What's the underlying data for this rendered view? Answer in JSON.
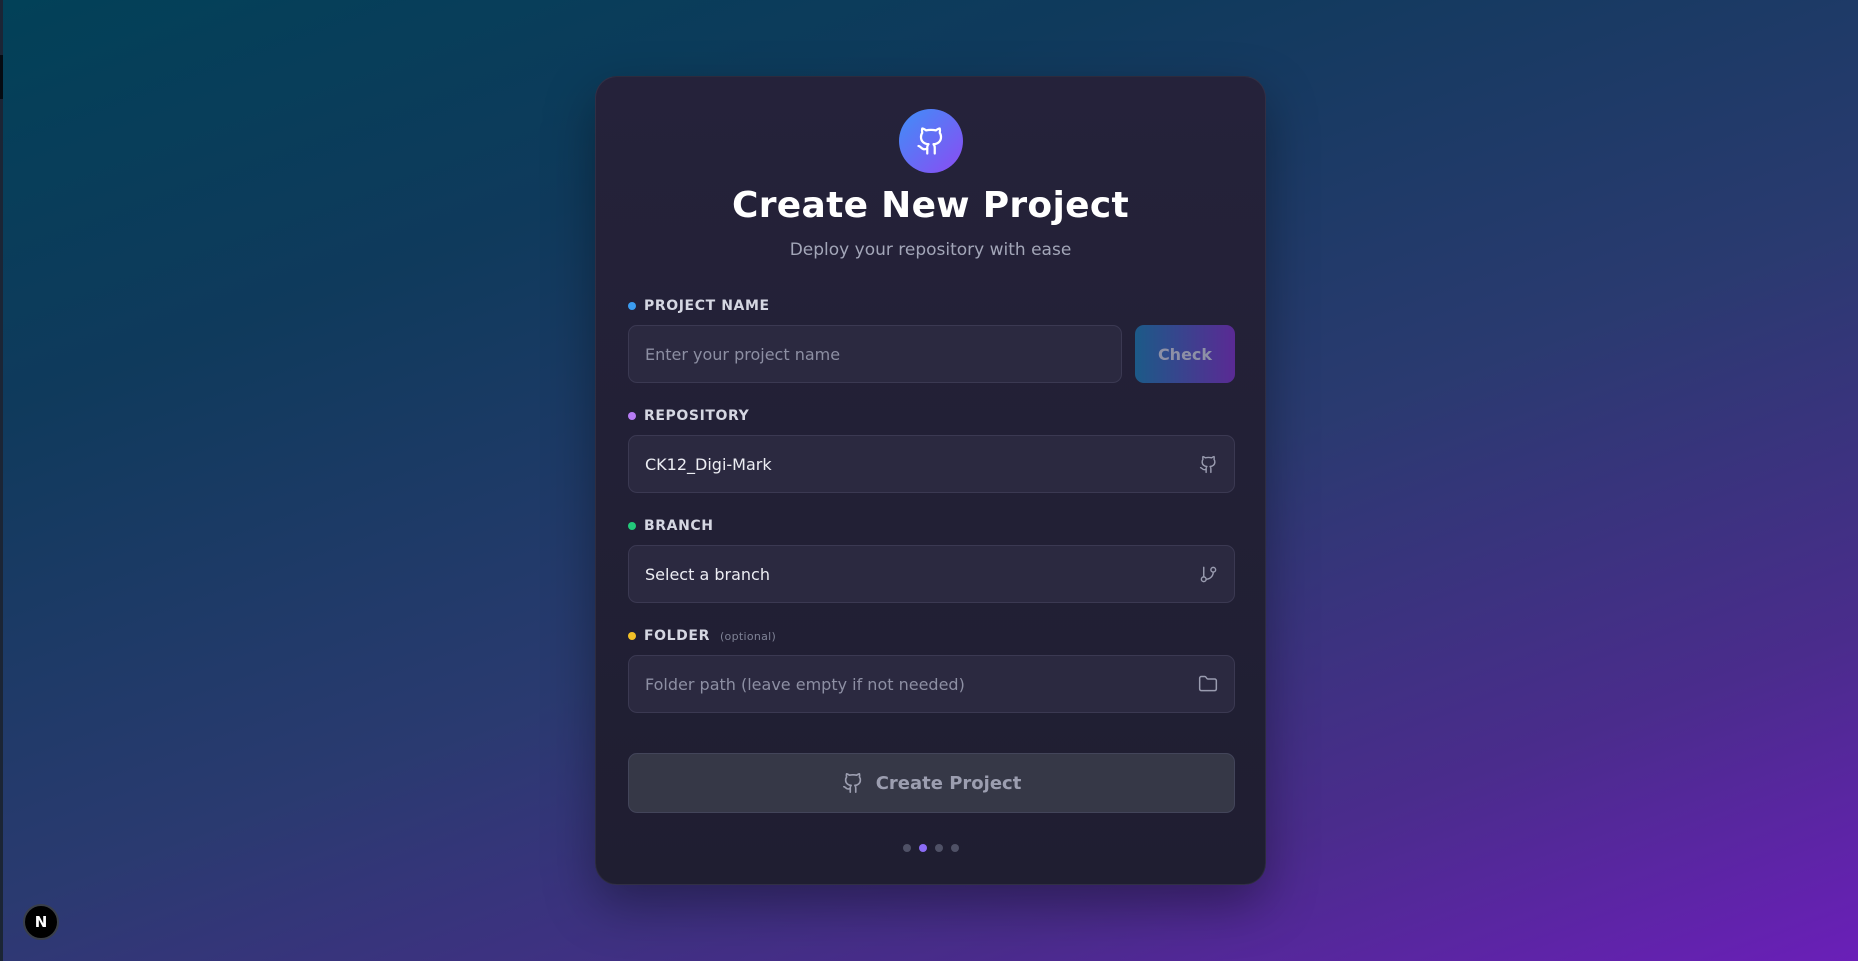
{
  "header": {
    "title": "Create New Project",
    "subtitle": "Deploy your repository with ease",
    "logo_icon": "github-icon"
  },
  "fields": {
    "project_name": {
      "label": "PROJECT NAME",
      "dot_color": "#3b9cf0",
      "placeholder": "Enter your project name",
      "value": "",
      "check_label": "Check"
    },
    "repository": {
      "label": "REPOSITORY",
      "dot_color": "#b77cf5",
      "value": "CK12_Digi-Mark",
      "icon": "github-icon"
    },
    "branch": {
      "label": "BRANCH",
      "dot_color": "#22c97a",
      "value": "Select a branch",
      "icon": "git-branch-icon"
    },
    "folder": {
      "label": "FOLDER",
      "optional": "(optional)",
      "dot_color": "#f2c027",
      "placeholder": "Folder path (leave empty if not needed)",
      "value": "",
      "icon": "folder-icon"
    }
  },
  "actions": {
    "create_label": "Create Project",
    "create_icon": "github-icon"
  },
  "pager": {
    "count": 4,
    "active_index": 1
  },
  "badge": {
    "label": "N"
  },
  "colors": {
    "accent_start": "#3f8ff8",
    "accent_end": "#8b4bf2",
    "card_bg": "#23213a"
  }
}
